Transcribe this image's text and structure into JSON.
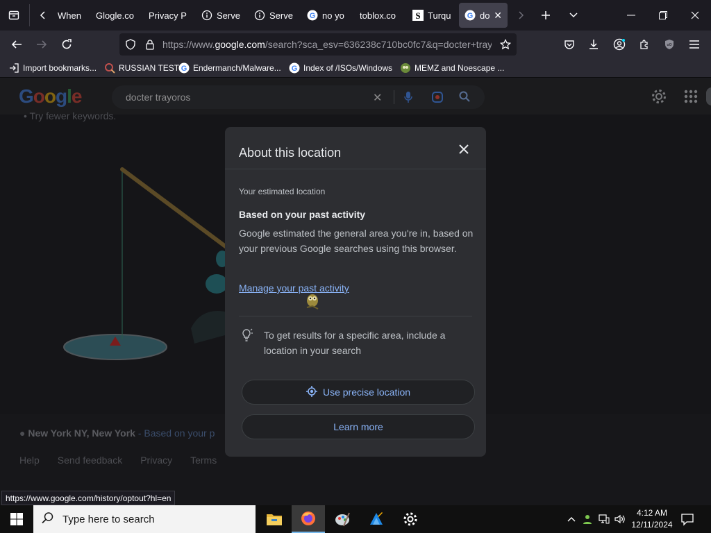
{
  "tabs": [
    {
      "title": "When",
      "favicon": "none"
    },
    {
      "title": "Glogle.co",
      "favicon": "none"
    },
    {
      "title": "Privacy P",
      "favicon": "none"
    },
    {
      "title": "Serve",
      "favicon": "info-icon"
    },
    {
      "title": "Serve",
      "favicon": "info-icon"
    },
    {
      "title": "no yo",
      "favicon": "google-icon"
    },
    {
      "title": "toblox.co",
      "favicon": "none"
    },
    {
      "title": "Turqu",
      "favicon": "s-icon"
    },
    {
      "title": "doc",
      "favicon": "google-icon",
      "active": true
    }
  ],
  "url": {
    "prefix": "https://www.",
    "domain": "google.com",
    "rest": "/search?sca_esv=636238c710bc0fc7&q=docter+tray"
  },
  "bookmarks": [
    {
      "label": "Import bookmarks...",
      "icon": "import-icon"
    },
    {
      "label": "RUSSIAN TEST",
      "icon": "magnifier-icon"
    },
    {
      "label": "Endermanch/Malware...",
      "icon": "google-icon"
    },
    {
      "label": "Index of /ISOs/Windows",
      "icon": "google-icon"
    },
    {
      "label": "MEMZ and Noescape ...",
      "icon": "creature-icon"
    }
  ],
  "google": {
    "logo": "Google",
    "query": "docter trayoros",
    "tip": "Try fewer keywords.",
    "location": {
      "place": "New York NY, New York",
      "suffix": " - Based on your p"
    },
    "footer_links": [
      "Help",
      "Send feedback",
      "Privacy",
      "Terms"
    ]
  },
  "status_url": "https://www.google.com/history/optout?hl=en",
  "dialog": {
    "title": "About this location",
    "subtitle": "Your estimated location",
    "heading": "Based on your past activity",
    "body": "Google estimated the general area you're in, based on your previous Google searches using this browser.",
    "link": "Manage your past activity",
    "tip": "To get results for a specific area, include a location in your search",
    "precise_button": "Use precise location",
    "learn_button": "Learn more"
  },
  "taskbar": {
    "search_placeholder": "Type here to search",
    "time": "4:12 AM",
    "date": "12/11/2024"
  },
  "colors": {
    "link": "#8ab4f8",
    "dialog_bg": "#2d2e32",
    "page_bg": "#151518"
  }
}
